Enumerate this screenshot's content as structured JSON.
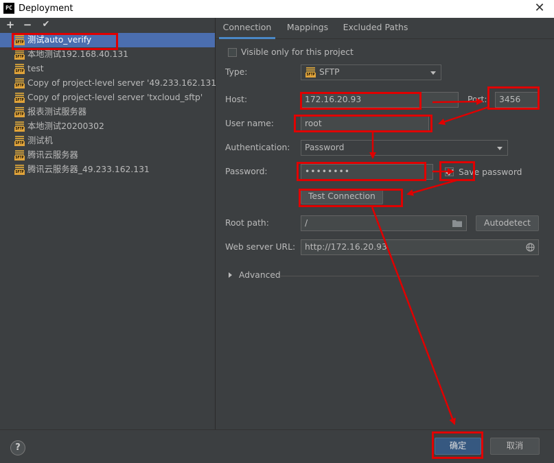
{
  "window": {
    "app_icon": "PC",
    "title": "Deployment",
    "close": "✕"
  },
  "toolbar": {
    "add": "+",
    "remove": "−",
    "default": "✔"
  },
  "server_icon_tag": "SFTP",
  "servers": [
    "测试auto_verify",
    "本地测试192.168.40.131",
    "test",
    "Copy of project-level server '49.233.162.131'",
    "Copy of project-level server 'txcloud_sftp'",
    "报表测试服务器",
    "本地测试20200302",
    "测试机",
    "腾讯云服务器",
    "腾讯云服务器_49.233.162.131"
  ],
  "tabs": [
    "Connection",
    "Mappings",
    "Excluded Paths"
  ],
  "form": {
    "visible_only_label": "Visible only for this project",
    "type_label": "Type:",
    "type_value": "SFTP",
    "host_label": "Host:",
    "host_value": "172.16.20.93",
    "port_label": "Port:",
    "port_value": "3456",
    "username_label": "User name:",
    "username_value": "root",
    "auth_label": "Authentication:",
    "auth_value": "Password",
    "password_label": "Password:",
    "password_value": "••••••••",
    "save_password_label": "Save password",
    "test_connection_label": "Test Connection",
    "root_path_label": "Root path:",
    "root_path_value": "/",
    "autodetect_label": "Autodetect",
    "web_url_label": "Web server URL:",
    "web_url_value": "http://172.16.20.93",
    "advanced_label": "Advanced"
  },
  "footer": {
    "help": "?",
    "ok": "确定",
    "cancel": "取消"
  },
  "colors": {
    "selection": "#4b6eaf",
    "accent_tab": "#4a88c7",
    "annotation": "#e00000"
  }
}
